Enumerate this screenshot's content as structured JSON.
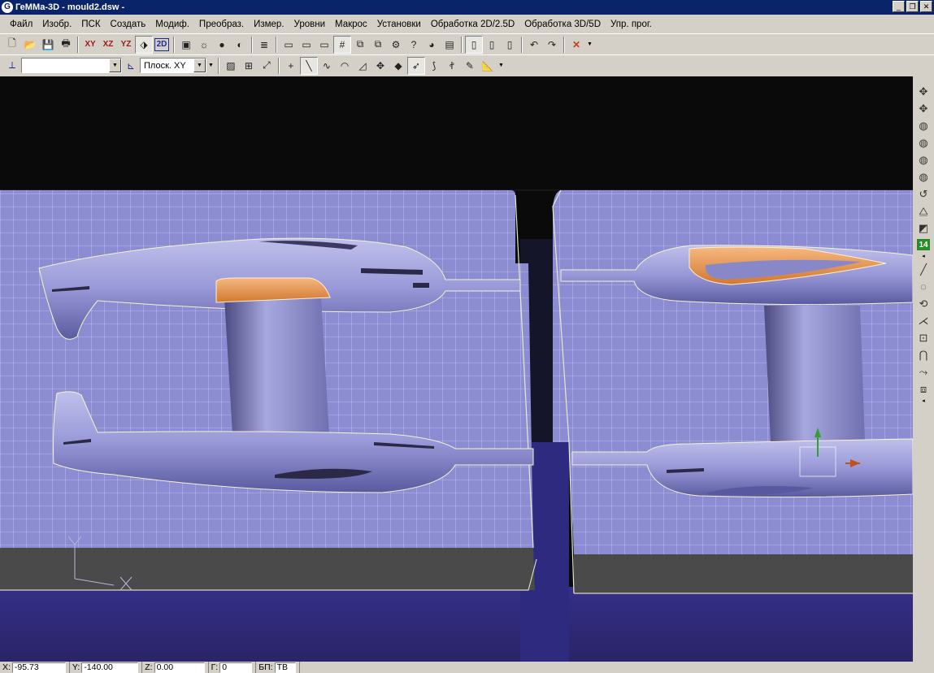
{
  "window": {
    "title": "ГеММа-3D - mould2.dsw -",
    "app_icon": "G"
  },
  "menu": {
    "items": [
      "Файл",
      "Изобр.",
      "ПСК",
      "Создать",
      "Модиф.",
      "Преобраз.",
      "Измер.",
      "Уровни",
      "Макрос",
      "Установки",
      "Обработка 2D/2.5D",
      "Обработка 3D/5D",
      "Упр. прог."
    ]
  },
  "toolbar1": {
    "xy_label": "XY",
    "xz_label": "XZ",
    "yz_label": "YZ",
    "twod_label": "2D"
  },
  "toolbar2": {
    "layer_combo_value": "",
    "plane_combo_value": "Плоск. XY"
  },
  "right_toolbar": {
    "level_number": "14"
  },
  "status": {
    "x_label": "X:",
    "x_value": "-95.73",
    "y_label": "Y:",
    "y_value": "-140.00",
    "z_label": "Z:",
    "z_value": "0.00",
    "g_label": "Г:",
    "g_value": "0",
    "bp_label": "БП:",
    "bp_value": "ТВ"
  },
  "colors": {
    "viewport_background": "#0a0a0a",
    "floor_color": "#2f2a7a",
    "mould_surface": "#8c8cd2",
    "highlight_orange": "#f0a060",
    "title_bar": "#0a246a"
  }
}
